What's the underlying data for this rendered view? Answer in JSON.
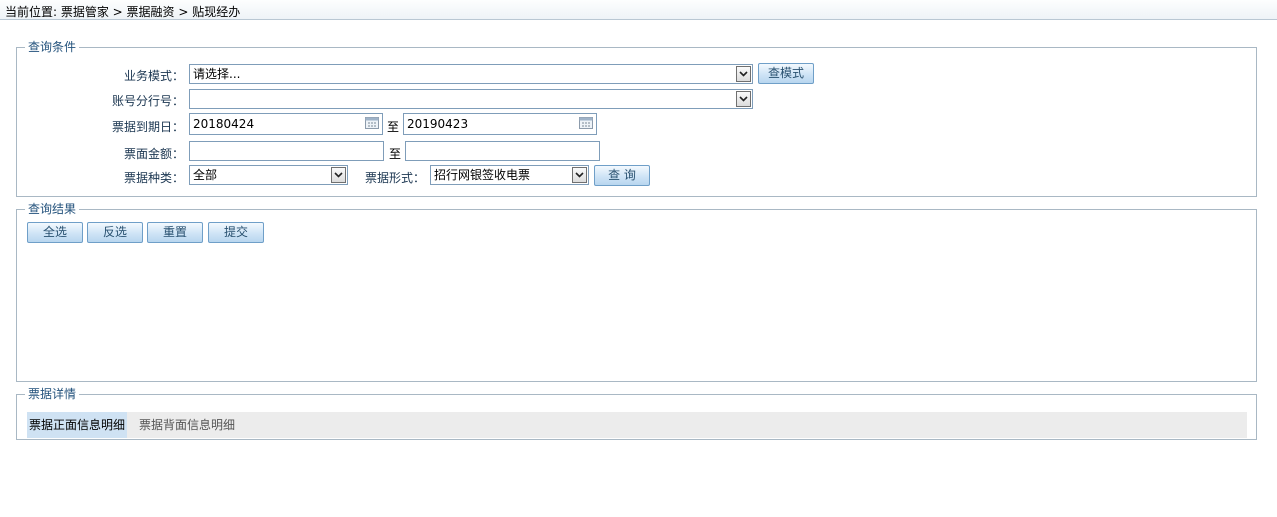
{
  "breadcrumb": "当前位置: 票据管家 > 票据融资 > 贴现经办",
  "query": {
    "legend": "查询条件",
    "business_mode_label": "业务模式：",
    "business_mode_value": "请选择...",
    "check_mode_button": "查模式",
    "account_branch_label": "账号分行号：",
    "account_branch_value": "",
    "due_date_label": "票据到期日：",
    "due_date_from": "20180424",
    "to": "至",
    "due_date_to": "20190423",
    "amount_label": "票面金额：",
    "amount_from": "",
    "amount_to": "",
    "bill_type_label": "票据种类：",
    "bill_type_value": "全部",
    "bill_form_label": "票据形式：",
    "bill_form_value": "招行网银签收电票",
    "search_button": "查 询"
  },
  "results": {
    "legend": "查询结果",
    "buttons": {
      "select_all": "全选",
      "invert": "反选",
      "reset": "重置",
      "submit": "提交"
    }
  },
  "details": {
    "legend": "票据详情",
    "tabs": [
      "票据正面信息明细",
      "票据背面信息明细"
    ]
  }
}
